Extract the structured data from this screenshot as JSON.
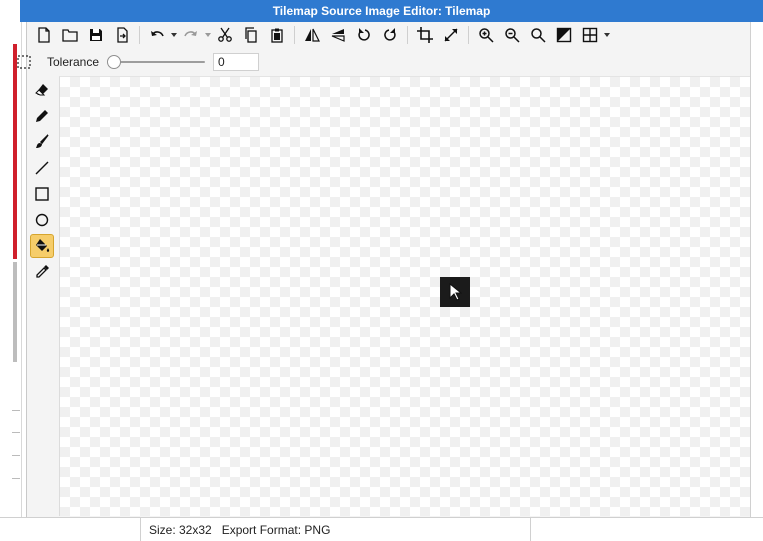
{
  "window": {
    "title": "Tilemap Source Image Editor: Tilemap"
  },
  "toolbar": {
    "buttons": [
      {
        "icon": "new-file-icon"
      },
      {
        "icon": "open-folder-icon"
      },
      {
        "icon": "save-icon"
      },
      {
        "icon": "export-icon"
      },
      {
        "icon": "undo-icon"
      },
      {
        "icon": "redo-icon"
      },
      {
        "icon": "cut-icon"
      },
      {
        "icon": "copy-icon"
      },
      {
        "icon": "paste-icon"
      },
      {
        "icon": "flip-horizontal-icon"
      },
      {
        "icon": "flip-vertical-icon"
      },
      {
        "icon": "rotate-left-icon"
      },
      {
        "icon": "rotate-right-icon"
      },
      {
        "icon": "crop-icon"
      },
      {
        "icon": "resize-icon"
      },
      {
        "icon": "zoom-in-icon"
      },
      {
        "icon": "zoom-out-icon"
      },
      {
        "icon": "zoom-fit-icon"
      },
      {
        "icon": "background-icon"
      },
      {
        "icon": "grid-icon"
      }
    ]
  },
  "tolerance": {
    "label": "Tolerance",
    "value": "0",
    "slider_fraction": 0
  },
  "tools": [
    {
      "icon": "eraser-icon",
      "active": false
    },
    {
      "icon": "pencil-icon",
      "active": false
    },
    {
      "icon": "brush-icon",
      "active": false
    },
    {
      "icon": "line-icon",
      "active": false
    },
    {
      "icon": "rectangle-icon",
      "active": false
    },
    {
      "icon": "ellipse-icon",
      "active": false
    },
    {
      "icon": "paint-bucket-icon",
      "active": true
    },
    {
      "icon": "eyedropper-icon",
      "active": false
    }
  ],
  "colors": {
    "title_bar": "#2f7ad0",
    "active_tool": "#f6cd6a"
  },
  "status": {
    "text": "Size: 32x32   Export Format: PNG"
  }
}
